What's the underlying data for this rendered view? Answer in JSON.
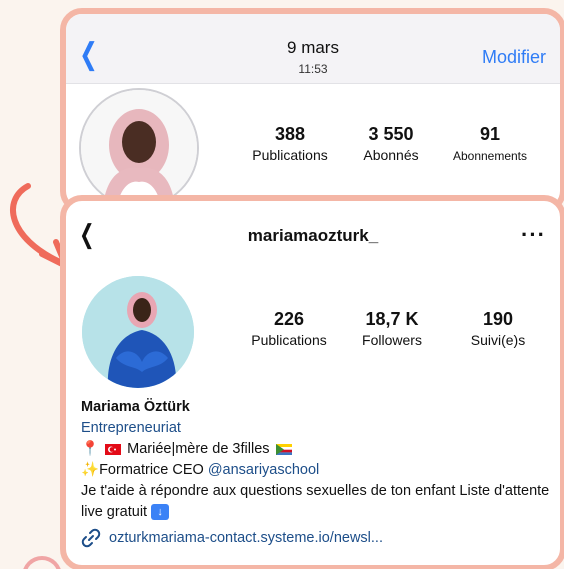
{
  "colors": {
    "frame": "#f4b6a6",
    "arrow": "#ef6b5b",
    "accent": "#2f7cf6",
    "link": "#1d4e89"
  },
  "top_card": {
    "date": "9 mars",
    "time": "11:53",
    "back_icon": "chevron-left-icon",
    "modify_label": "Modifier",
    "stats": [
      {
        "num": "388",
        "label": "Publications"
      },
      {
        "num": "3 550",
        "label": "Abonnés"
      },
      {
        "num": "91",
        "label": "Abonnements"
      }
    ]
  },
  "bottom_card": {
    "username": "mariamaozturk_",
    "back_icon": "chevron-left-icon",
    "more_icon": "more-icon",
    "stats": [
      {
        "num": "226",
        "label": "Publications"
      },
      {
        "num": "18,7 K",
        "label": "Followers"
      },
      {
        "num": "190",
        "label": "Suivi(e)s"
      }
    ],
    "bio": {
      "name": "Mariama Öztürk",
      "category": "Entrepreneuriat",
      "line1": "Mariée|mère de 3filles",
      "line2_prefix": "Formatrice CEO ",
      "line2_mention": "@ansariyaschool",
      "line3": "Je t'aide à répondre aux questions sexuelles de ton enfant Liste d'attente live gratuit"
    },
    "link": "ozturkmariama-contact.systeme.io/newsl..."
  }
}
